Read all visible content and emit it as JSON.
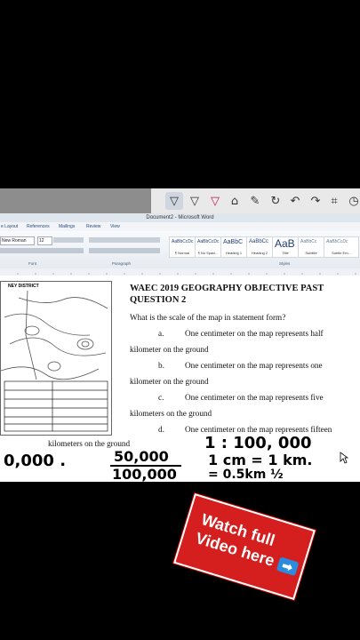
{
  "window": {
    "title": "Document2 - Microsoft Word"
  },
  "pen_toolbar": {
    "tools": [
      "pen-black-icon",
      "pen-dark-icon",
      "pen-red-icon",
      "eraser-icon",
      "highlighter-icon",
      "lasso-icon",
      "undo-icon",
      "redo-icon",
      "crop-icon",
      "history-icon"
    ]
  },
  "ribbon": {
    "tabs": [
      "e Layout",
      "References",
      "Mailings",
      "Review",
      "View"
    ],
    "font_name": "New Roman",
    "font_size": "12",
    "groups": [
      "Font",
      "Paragraph",
      "Styles"
    ],
    "styles": [
      {
        "sample": "AaBbCcDc",
        "name": "¶ Normal"
      },
      {
        "sample": "AaBbCcDc",
        "name": "¶ No Spaci..."
      },
      {
        "sample": "AaBbC",
        "name": "Heading 1"
      },
      {
        "sample": "AaBbCc",
        "name": "Heading 2"
      },
      {
        "sample": "AaB",
        "name": "Title"
      },
      {
        "sample": "AaBbCc",
        "name": "Subtitle"
      },
      {
        "sample": "AaBbCcDc",
        "name": "Subtle Em..."
      }
    ]
  },
  "document": {
    "map_label": "NEY DISTRICT",
    "title_line1": "WAEC 2019 GEOGRAPHY OBJECTIVE PAST",
    "title_line2": "QUESTION 2",
    "question": "What is the scale of the map in statement form?",
    "options": [
      {
        "letter": "a.",
        "text": "One  centimeter  on  the  map  represents  half",
        "cont": "kilometer on the ground"
      },
      {
        "letter": "b.",
        "text": "One  centimeter  on  the  map  represents  one",
        "cont": "kilometer on the ground"
      },
      {
        "letter": "c.",
        "text": "One  centimeter  on  the  map  represents  five",
        "cont": "kilometers on the ground"
      },
      {
        "letter": "d.",
        "text": "One  centimeter  on  the  map  represents  fifteen",
        "cont": "kilometers on the ground"
      }
    ]
  },
  "handwriting": {
    "left": "0,000 .",
    "fraction_top": "50,000",
    "fraction_bottom": "100,000",
    "ratio": "1 : 100, 000",
    "equation": "1 cm = 1 km.",
    "bottom": "= 0.5km ½"
  },
  "promo": {
    "line1": "Watch full",
    "line2": "Video here",
    "arrow": "➡"
  }
}
